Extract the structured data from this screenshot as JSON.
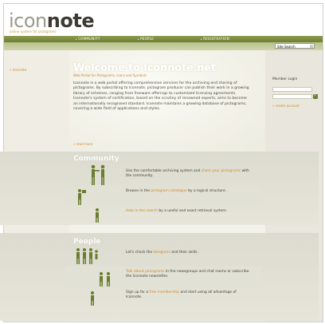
{
  "header": {
    "logo_light": "icon",
    "logo_bold": "note",
    "tagline": "online system for pictograms"
  },
  "nav": {
    "items": [
      "COMMUNITY",
      "PEOPLE",
      "REGISTRATION"
    ]
  },
  "search": {
    "selected": "Site Search"
  },
  "sidebar_left": {
    "link": "» Iconnote"
  },
  "main": {
    "title": "Welcome to Iconnote.net",
    "subtitle": "Web Portal for Pictograms, Icons and Symbols",
    "intro": "Iconnote is a web portal offering comprehensive services for the archiving and sharing of pictograms. By subscribing to Iconnote, pictogram producer can publish their work in a growing library of schemes, ranging from freeware offerings to customized licensing agreements. Iconnote's system of certification, based on the scrutiny of renowned experts, aims to become an internationally recognised standard. Iconnote maintains a growing database of pictograms, covering a wide field of applications and styles.",
    "read_more": "» read more"
  },
  "community": {
    "title": "Community",
    "rows": [
      {
        "pre": "Use the comfortable archiving system and ",
        "link": "share your pictograms",
        "post": " with the community."
      },
      {
        "pre": "Browse in the ",
        "link": "pictogram catalogue",
        "post": " by a logical structure."
      },
      {
        "pre": "",
        "link": "Help in the search",
        "post": " by a useful and exact retrieval system."
      }
    ]
  },
  "people": {
    "title": "People",
    "rows": [
      {
        "pre": "Let's check the ",
        "link": "designers",
        "post": " and their skills."
      },
      {
        "pre": "",
        "link": "Talk about pictograms",
        "post": " in the newsgroups and chat rooms or subscribe the Iconnote newsletter."
      },
      {
        "pre": "Sign up for a ",
        "link": "free membership",
        "post": " and start using all advantage of Iconnote."
      }
    ]
  },
  "sidebar_right": {
    "member_login": "Member Login",
    "create_account": "» create account"
  },
  "colors": {
    "nav_green": "#6f7e37",
    "accent_orange": "#d08a2a",
    "figure_green": "#6b7d2e"
  }
}
